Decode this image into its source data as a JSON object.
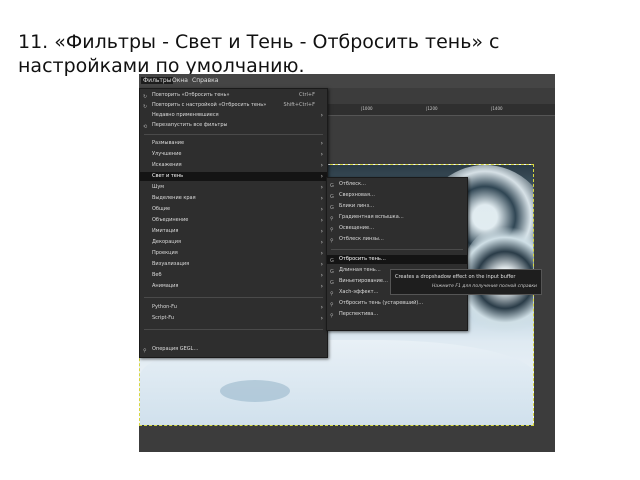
{
  "caption": "11. «Фильтры - Свет и Тень - Отбросить тень» с настройками по умолчанию.",
  "menubar": {
    "filters": "Фильтры",
    "windows": "Окна",
    "help": "Справка"
  },
  "ruler": {
    "t1": "|1000",
    "t2": "|1200",
    "t3": "|1400"
  },
  "filters_menu": {
    "repeat": "Повторить «Отбросить тень»",
    "repeat_shortcut": "Ctrl+F",
    "reshow": "Повторить с настройкой «Отбросить тень»",
    "reshow_shortcut": "Shift+Ctrl+F",
    "recent": "Недавно применявшиеся",
    "reset": "Перезапустить все фильтры",
    "groups": [
      "Размывание",
      "Улучшение",
      "Искажения",
      "Свет и тень",
      "Шум",
      "Выделение края",
      "Общие",
      "Объединение",
      "Имитация",
      "Декорация",
      "Проекция",
      "Визуализация",
      "Веб",
      "Анимация"
    ],
    "python": "Python-Fu",
    "script": "Script-Fu",
    "gegl": "Операция GEGL…"
  },
  "light_shadow_menu": {
    "items_top": [
      "Отблеск…",
      "Сверхновая…",
      "Блики линз…",
      "Градиентная вспышка…",
      "Освещение…",
      "Отблеск линзы…"
    ],
    "items_bottom": [
      "Отбросить тень…",
      "Длинная тень…",
      "Виньетирование…",
      "Xach-эффект…",
      "Отбросить тень (устаревший)…",
      "Перспектива…"
    ]
  },
  "tooltip": {
    "text": "Creates a dropshadow effect on the input buffer",
    "hint": "Нажмите F1 для получения полной справки"
  }
}
